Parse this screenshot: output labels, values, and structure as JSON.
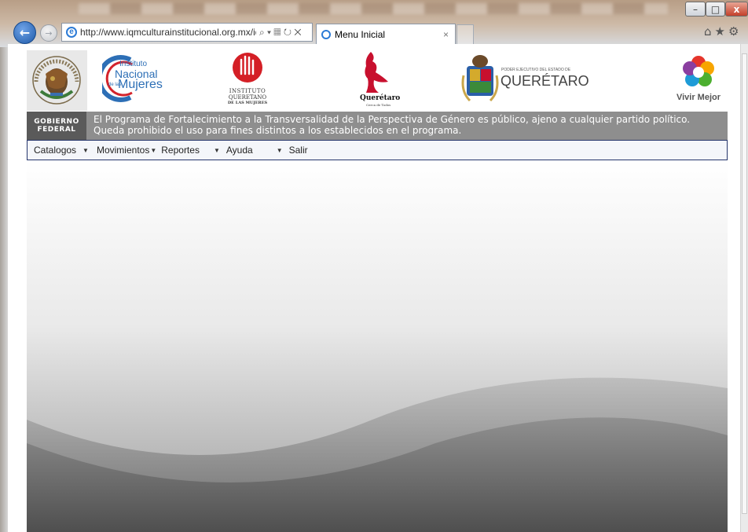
{
  "browser": {
    "address_url": "http://www.iqmculturainstitucional.org.mx/iqr",
    "address_icons": "⌕ ▾ ▦ ↻ ✕",
    "tab_title": "Menu Inicial",
    "tab_close": "×",
    "toolbar_icons": "⌂★⚙",
    "window_buttons": {
      "minimize": "–",
      "maximize": "□",
      "close": "x"
    }
  },
  "logos": {
    "inst_nacional_mujeres": {
      "line1": "Instituto",
      "line2": "Nacional",
      "line3": "Mujeres",
      "prefix": "de las"
    },
    "inst_queretano": {
      "line1": "INSTITUTO",
      "line2": "QUERETANO",
      "line3": "DE LAS MUJERES"
    },
    "queretaro_city": {
      "name": "Querétaro",
      "tagline": "Cerca de Todos"
    },
    "poder_ejecutivo": {
      "small": "PODER EJECUTIVO DEL ESTADO DE",
      "big": "QUERÉTARO"
    },
    "vivir_mejor": {
      "text": "Vivir Mejor"
    }
  },
  "banner": {
    "gob_line1": "GOBIERNO",
    "gob_line2": "FEDERAL",
    "notice": "El Programa de Fortalecimiento a la Transversalidad de la Perspectiva de Género es público, ajeno a cualquier partido político. Queda prohibido el uso para fines distintos a los establecidos en el programa."
  },
  "menu": {
    "items": [
      {
        "label": "Catalogos",
        "arrow": "▼"
      },
      {
        "label": "Movimientos",
        "arrow": "▼"
      },
      {
        "label": "Reportes",
        "arrow": "▼"
      },
      {
        "label": "Ayuda",
        "arrow": "▼"
      },
      {
        "label": "Salir",
        "arrow": ""
      }
    ]
  },
  "colors": {
    "menu_border": "#25356b",
    "banner_gray": "#8e8e8e",
    "gobierno_gray": "#5a5a5a",
    "queretaro_red": "#c8102e",
    "inmujeres_blue": "#2d6fb6"
  }
}
